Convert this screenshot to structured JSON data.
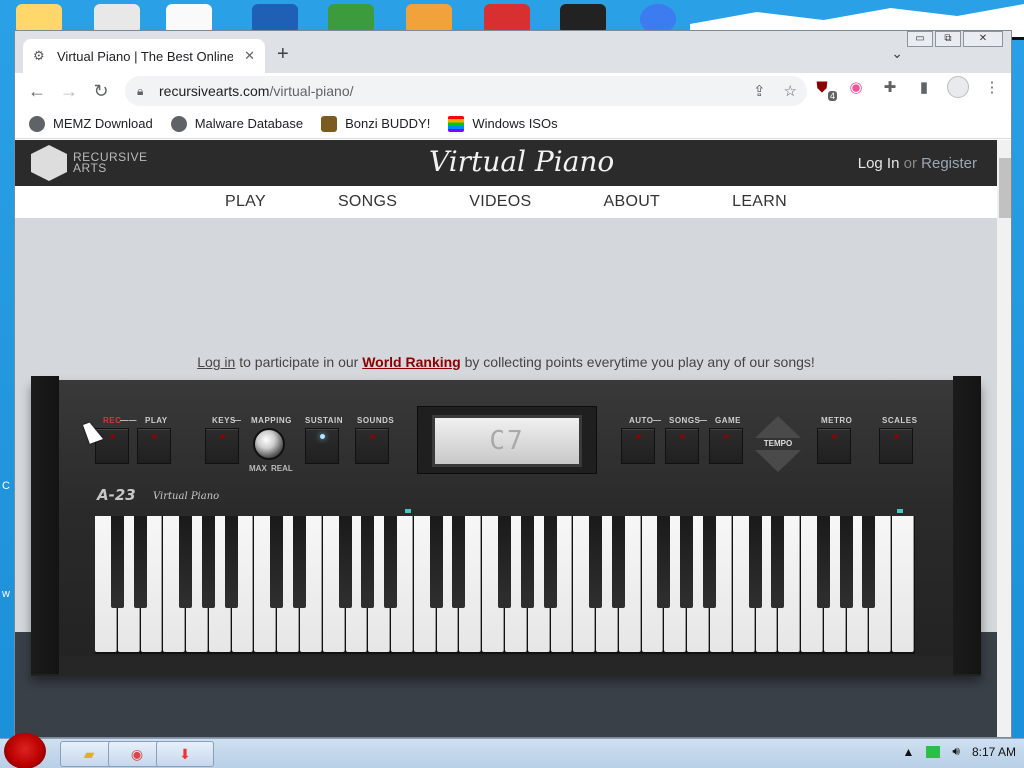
{
  "browser": {
    "tab_title": "Virtual Piano | The Best Online",
    "url_domain": "recursivearts.com",
    "url_path": "/virtual-piano/",
    "extension_badge": "4",
    "window_controls": {
      "minimize": "▭",
      "restore": "⧉",
      "close": "✕"
    },
    "bookmarks": [
      {
        "label": "MEMZ Download",
        "icon": "globe-icon"
      },
      {
        "label": "Malware Database",
        "icon": "globe-icon"
      },
      {
        "label": "Bonzi BUDDY!",
        "icon": "bonzi-icon"
      },
      {
        "label": "Windows ISOs",
        "icon": "rainbow-flag-icon"
      }
    ]
  },
  "site": {
    "logo_line1": "RECURSIVE",
    "logo_line2": "ARTS",
    "title": "Virtual Piano",
    "login": "Log In",
    "or": "or",
    "register": "Register",
    "nav": [
      "PLAY",
      "SONGS",
      "VIDEOS",
      "ABOUT",
      "LEARN"
    ],
    "rank_login": "Log in",
    "rank_text1": " to participate in our ",
    "rank_link": "World Ranking",
    "rank_text2": " by collecting points everytime you play any of our songs!"
  },
  "piano": {
    "labels": {
      "rec": "REC",
      "play": "PLAY",
      "keys": "KEYS",
      "mapping": "MAPPING",
      "sustain": "SUSTAIN",
      "sounds": "SOUNDS",
      "auto": "AUTO",
      "songs": "SONGS",
      "game": "GAME",
      "tempo": "TEMPO",
      "metro": "METRO",
      "scales": "SCALES",
      "max": "MAX",
      "real": "REAL"
    },
    "display": "C7",
    "model": "A-23",
    "model_sub": "Virtual Piano",
    "white_keys": 36
  },
  "taskbar": {
    "time": "8:17 AM"
  },
  "colors": {
    "accent_red": "#8b0000",
    "header_dark": "#2b2b2b",
    "page_bg": "#d4d8dc"
  }
}
